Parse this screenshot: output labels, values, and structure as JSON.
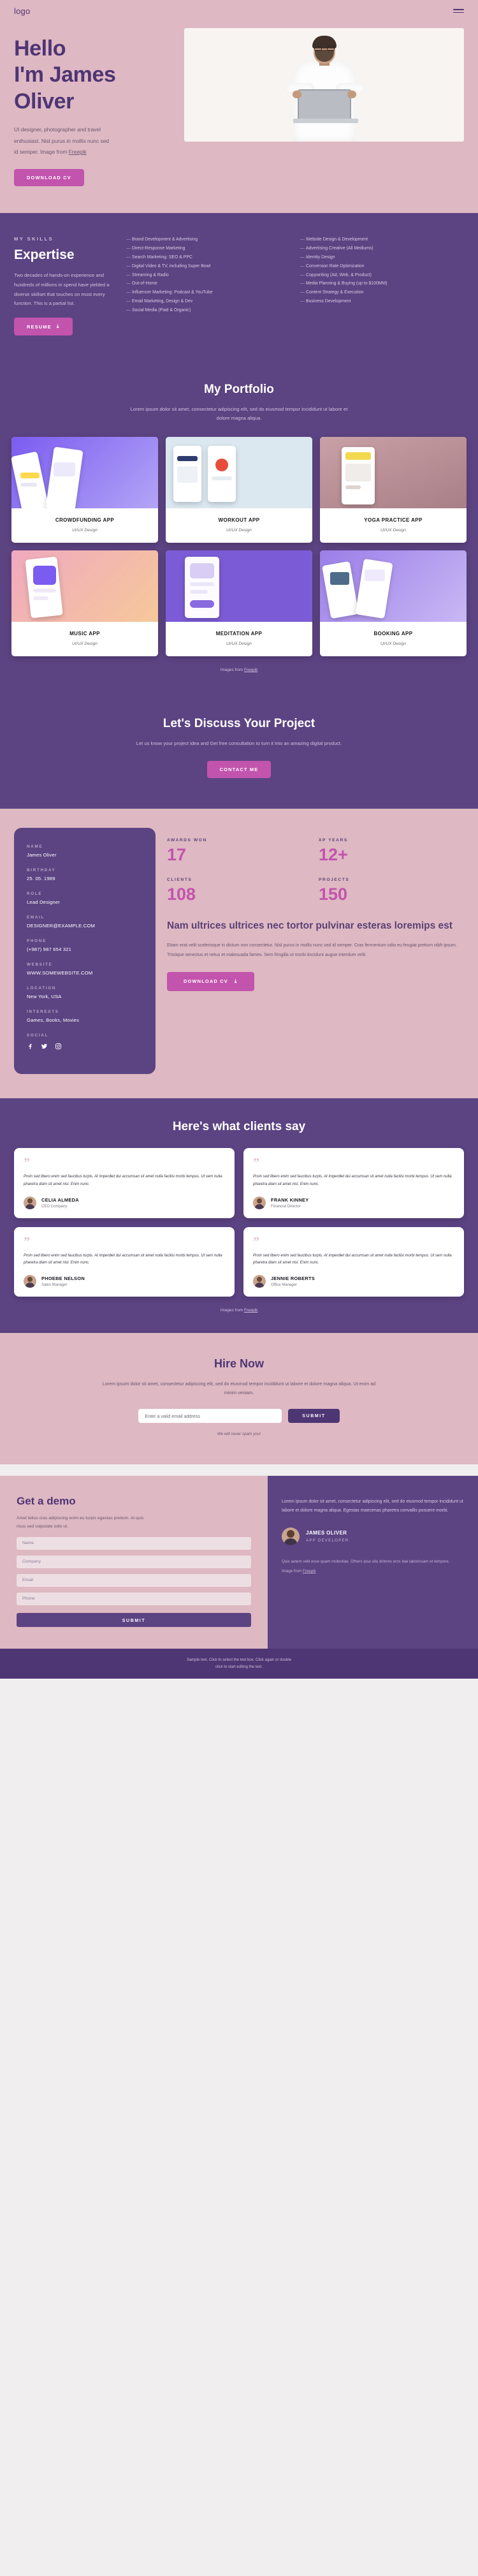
{
  "header": {
    "logo": "logo",
    "menu_icon": "hamburger-menu-icon"
  },
  "hero": {
    "title_line1": "Hello",
    "title_line2": "I'm James",
    "title_line3": "Oliver",
    "description": "UI designer, photographer and travel enthusiast. Nisl purus in mollis nunc sed id semper.  Image from ",
    "credit_link": "Freepik",
    "cta": "DOWNLOAD CV"
  },
  "skills": {
    "eyebrow": "MY SKILLS",
    "title": "Expertise",
    "paragraph": "Two decades of hands-on experience and hundreds of millions in spend have yielded a diverse skillset that touches on most every function. This is a partial list.",
    "button": "RESUME",
    "download_icon": "download-icon",
    "column1": [
      "Brand Development & Advertising",
      "Direct-Response Marketing",
      "Search Marketing: SEO & PPC",
      "Digital Video & TV, including Super Bowl",
      "Streaming & Radio",
      "Out-of-Home",
      "Influencer Marketing: Podcast & YouTube",
      "Email Marketing, Design & Dev",
      "Social Media (Paid & Organic)"
    ],
    "column2": [
      "Website Design & Development",
      "Advertising Creative (All Mediums)",
      "Identity Design",
      "Conversion Rate Optimization",
      "Copywriting (Ad, Web, & Product)",
      "Media Planning & Buying (up to $100MM)",
      "Content Strategy & Execution",
      "Business Development"
    ]
  },
  "portfolio": {
    "title": "My Portfolio",
    "subtitle": "Lorem ipsum dolor sit amet, consectetur adipiscing elit, sed do eiusmod tempor incididunt ut labore et dolore magna aliqua.",
    "credit_prefix": "Images from ",
    "credit_link": "Freepik",
    "items": [
      {
        "title": "CROWDFUNDING APP",
        "subtitle": "UI/UX Design"
      },
      {
        "title": "WORKOUT APP",
        "subtitle": "UI/UX Design"
      },
      {
        "title": "YOGA PRACTICE APP",
        "subtitle": "UI/UX Design"
      },
      {
        "title": "MUSIC APP",
        "subtitle": "UI/UX Design"
      },
      {
        "title": "MEDITATION APP",
        "subtitle": "UI/UX Design"
      },
      {
        "title": "BOOKING  APP",
        "subtitle": "UI/UX Design"
      }
    ]
  },
  "discuss": {
    "title": "Let's Discuss Your Project",
    "subtitle": "Let us know your project idea and Get free consultation to turn it into an amazing digital product.",
    "cta": "CONTACT ME"
  },
  "about": {
    "info": [
      {
        "label": "NAME",
        "value": "James Oliver"
      },
      {
        "label": "BIRTHDAY",
        "value": "25. 05. 1989"
      },
      {
        "label": "ROLE",
        "value": "Lead Designer"
      },
      {
        "label": "EMAIL",
        "value": "DESIGNER@EXAMPLE.COM"
      },
      {
        "label": "PHONE",
        "value": "(+987) 987 654 321"
      },
      {
        "label": "WEBSITE",
        "value": "WWW.SOMEWEBSITE.COM"
      },
      {
        "label": "LOCATION",
        "value": "New York, USA"
      },
      {
        "label": "INTERESTS",
        "value": "Games, Books, Movies"
      }
    ],
    "social_label": "SOCIAL",
    "social_icons": [
      "facebook-icon",
      "twitter-icon",
      "instagram-icon"
    ],
    "stats": [
      {
        "label": "AWARDS WON",
        "value": "17"
      },
      {
        "label": "XP YEARS",
        "value": "12+"
      },
      {
        "label": "CLIENTS",
        "value": "108"
      },
      {
        "label": "PROJECTS",
        "value": "150"
      }
    ],
    "headline": "Nam ultrices ultrices nec tortor pulvinar esteras loremips est",
    "paragraph": "Etiam erat velit scelerisque in dictum non consectetur. Nisl purus in mollis nunc sed id semper. Cras fermentum odio eu feugiat pretium nibh ipsum. Tristique senectus et netus et malesuada fames. Sem fringilla ut morbi tincidunt augue interdum velit.",
    "cta": "DOWNLOAD CV",
    "cta_icon": "download-icon"
  },
  "testimonials": {
    "title": "Here's what clients say",
    "quote_icon": "quote-mark-icon",
    "items": [
      {
        "quote": "Proin sed libero enim sed faucibus turpis. At imperdiet dui accumsan sit amet nulla facilisi morbi tempus. Ut sem nulla pharetra diam sit amet nisl. Enim nunc.",
        "name": "CELIA ALMEDA",
        "role": "CEO Company"
      },
      {
        "quote": "Proin sed libero enim sed faucibus turpis. At imperdiet dui accumsan sit amet nulla facilisi morbi tempus. Ut sem nulla pharetra diam sit amet nisl. Enim nunc.",
        "name": "FRANK KINNEY",
        "role": "Financial Director"
      },
      {
        "quote": "Proin sed libero enim sed faucibus turpis. At imperdiet dui accumsan sit amet nulla facilisi morbi tempus. Ut sem nulla pharetra diam sit amet nisl. Enim nunc.",
        "name": "PHOEBE NELSON",
        "role": "Sales Manager"
      },
      {
        "quote": "Proin sed libero enim sed faucibus turpis. At imperdiet dui accumsan sit amet nulla facilisi morbi tempus. Ut sem nulla pharetra diam sit amet nisl. Enim nunc.",
        "name": "JENNIE ROBERTS",
        "role": "Office Manager"
      }
    ],
    "credit_prefix": "Images from ",
    "credit_link": "Freepik"
  },
  "hire": {
    "title": "Hire Now",
    "paragraph": "Lorem ipsum dolor sit amet, consectetur adipiscing elit, sed do eiusmod tempor incididunt ut labore et dolore magna aliqua. Ut enim ad minim veniam.",
    "email_placeholder": "Enter a valid email address",
    "email_value": "",
    "submit": "SUBMIT",
    "note": "We will never spam you!"
  },
  "demo": {
    "title": "Get a demo",
    "paragraph": "Amet tellus cras adipiscing enim eu turpis egestas pretium. At quis risus sed vulputate odio ut.",
    "fields": [
      {
        "placeholder": "Name",
        "value": ""
      },
      {
        "placeholder": "Company",
        "value": ""
      },
      {
        "placeholder": "Email",
        "value": ""
      },
      {
        "placeholder": "Phone",
        "value": ""
      }
    ],
    "submit": "SUBMIT",
    "right_paragraph": "Lorem ipsum dolor sit amet, consectetur adipiscing elit, sed do eiusmod tempor incididunt ut labore et dolore magna aliqua. Egestas maecenas pharetra convallis posuere morbi.",
    "person_name": "JAMES OLIVER",
    "person_role": "APP DEVELOPER",
    "disclaimer": "Quis autem velit esse quam molestiae. Others ipsa sita dolores eros itae laboriosam et tempore.",
    "credit_prefix": "Image from ",
    "credit_link": "Freepik"
  },
  "footer": {
    "line1": "Sample text. Click to select the text box. Click again or double",
    "line2": "click to start editing the text."
  },
  "colors": {
    "pink_bg": "#deb8c2",
    "purple_bg": "#5c4382",
    "deep_purple": "#4e3574",
    "accent_magenta": "#c254ad"
  }
}
